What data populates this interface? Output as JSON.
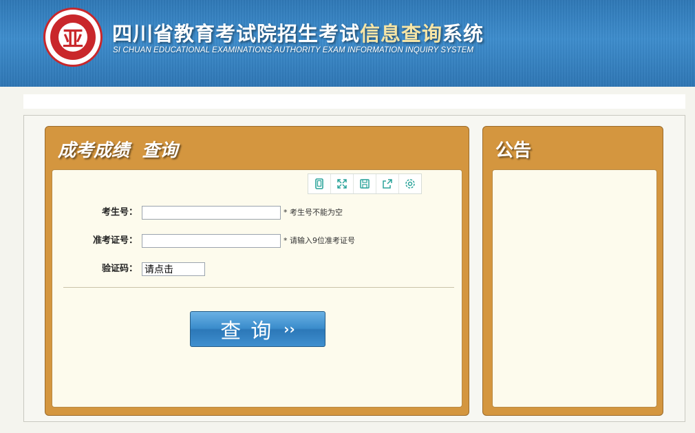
{
  "header": {
    "logo_text": "四川省教育考试院",
    "logo_mark": "亚",
    "title_prefix": "四川省教育考试院招生考试",
    "title_highlight": "信息查询",
    "title_suffix": "系统",
    "subtitle": "SI CHUAN EDUCATIONAL EXAMINATIONS AUTHORITY EXAM INFORMATION INQUIRY SYSTEM"
  },
  "query_panel": {
    "title": "成考成绩  查询",
    "toolbar": {
      "icons": [
        "tablet-icon",
        "fullscreen-icon",
        "save-icon",
        "share-icon",
        "settings-icon"
      ]
    },
    "fields": {
      "exam_id": {
        "label": "考生号：",
        "value": "",
        "hint": "* 考生号不能为空"
      },
      "admission_id": {
        "label": "准考证号：",
        "value": "",
        "hint": "* 请输入9位准考证号"
      },
      "captcha": {
        "label": "验证码：",
        "value": "请点击"
      }
    },
    "submit_label": "查询",
    "submit_arrow": "››"
  },
  "notice_panel": {
    "title": "公告"
  },
  "colors": {
    "header_blue": "#3d8ccc",
    "panel_orange": "#d4963f",
    "panel_body": "#fdfbed",
    "title_highlight": "#f6e5a6",
    "toolbar_icon": "#2aa39a"
  }
}
